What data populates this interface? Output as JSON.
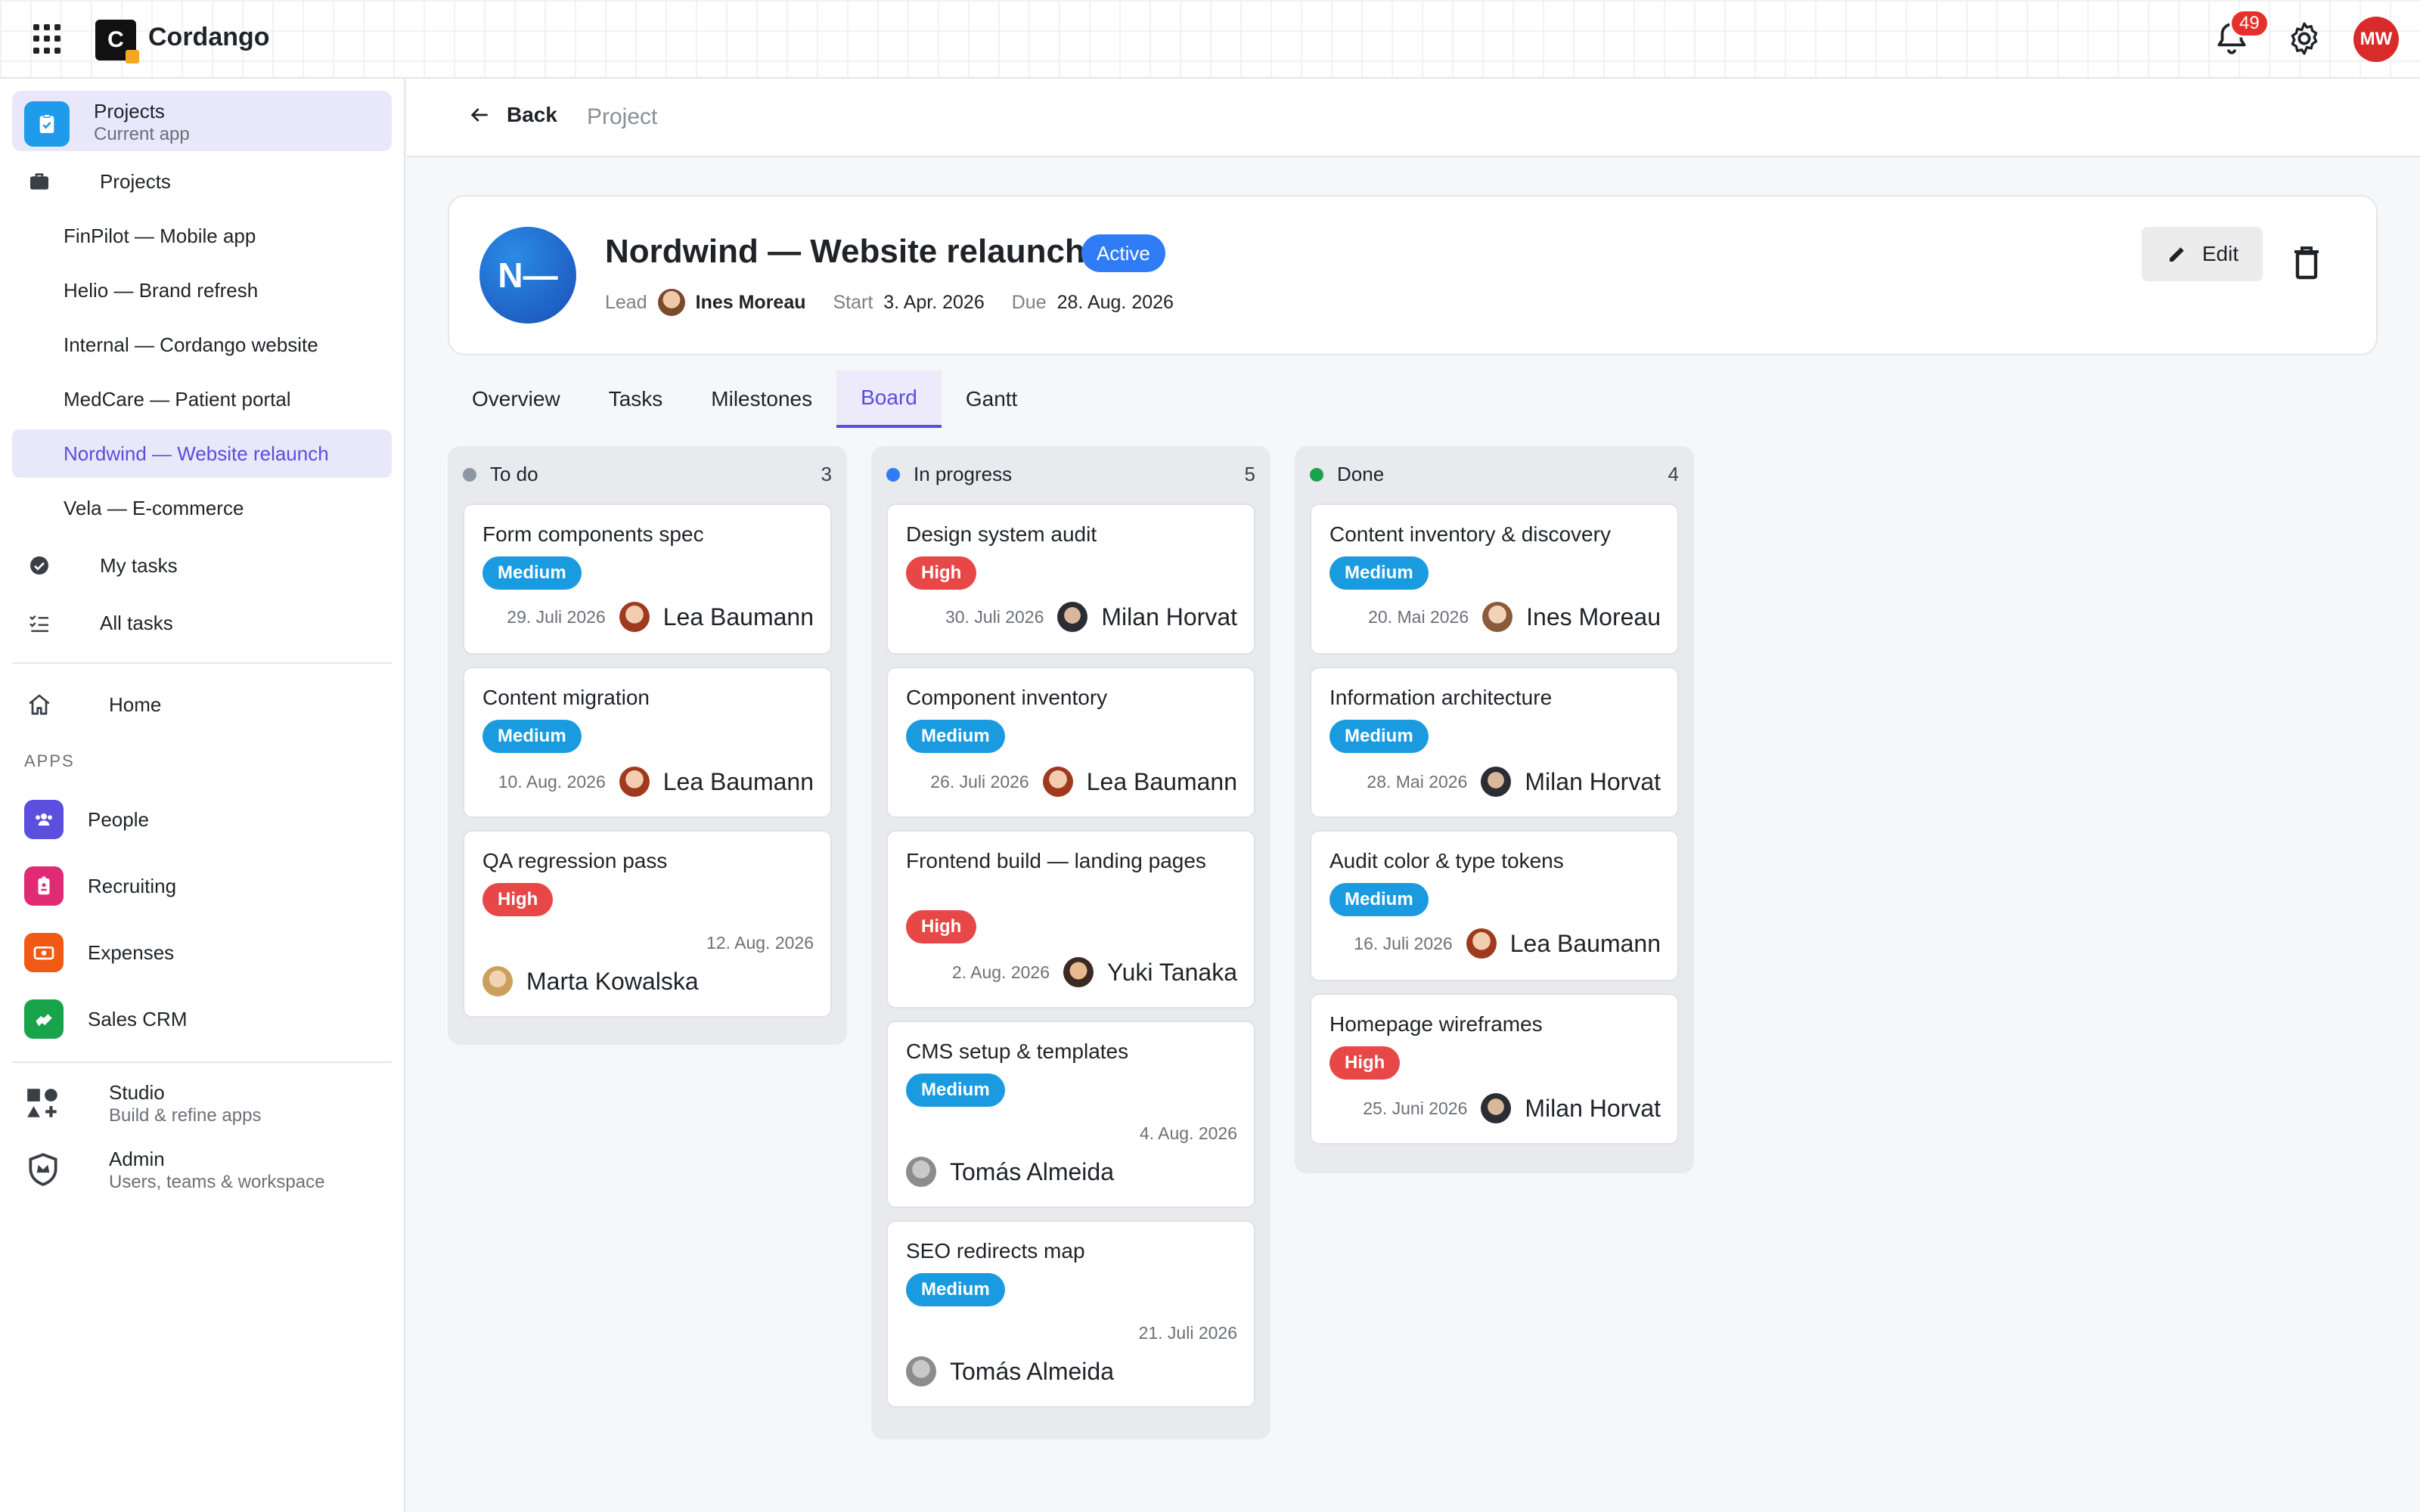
{
  "topbar": {
    "brand": "Cordango",
    "logo_letter": "C",
    "notifications_count": "49",
    "user_initials": "MW"
  },
  "sidebar": {
    "current_app": {
      "title": "Projects",
      "subtitle": "Current app"
    },
    "projects_label": "Projects",
    "projects": [
      "FinPilot — Mobile app",
      "Helio — Brand refresh",
      "Internal — Cordango website",
      "MedCare — Patient portal",
      "Nordwind — Website relaunch",
      "Vela — E-commerce"
    ],
    "active_project_index": 4,
    "my_tasks": "My tasks",
    "all_tasks": "All tasks",
    "home": "Home",
    "apps_heading": "APPS",
    "apps": [
      {
        "label": "People",
        "color": "#5b4fe0",
        "icon": "people-icon"
      },
      {
        "label": "Recruiting",
        "color": "#e02a74",
        "icon": "badge-icon"
      },
      {
        "label": "Expenses",
        "color": "#f05a14",
        "icon": "money-icon"
      },
      {
        "label": "Sales CRM",
        "color": "#19a34a",
        "icon": "handshake-icon"
      }
    ],
    "studio": {
      "title": "Studio",
      "subtitle": "Build & refine apps"
    },
    "admin": {
      "title": "Admin",
      "subtitle": "Users, teams & workspace"
    }
  },
  "breadcrumb": {
    "back": "Back",
    "current": "Project"
  },
  "project": {
    "initials": "N—",
    "title": "Nordwind — Website relaunch",
    "status": "Active",
    "lead_label": "Lead",
    "lead": "Ines Moreau",
    "start_label": "Start",
    "start": "3. Apr. 2026",
    "due_label": "Due",
    "due": "28. Aug. 2026",
    "edit_label": "Edit"
  },
  "tabs": [
    "Overview",
    "Tasks",
    "Milestones",
    "Board",
    "Gantt"
  ],
  "active_tab": "Board",
  "board": {
    "columns": [
      {
        "name": "To do",
        "count": "3",
        "color": "#8e96a3",
        "cards": [
          {
            "title": "Form components spec",
            "priority": "Medium",
            "date": "29. Juli 2026",
            "assignee": "Lea Baumann"
          },
          {
            "title": "Content migration",
            "priority": "Medium",
            "date": "10. Aug. 2026",
            "assignee": "Lea Baumann"
          },
          {
            "title": "QA regression pass",
            "priority": "High",
            "date": "12. Aug. 2026",
            "assignee": "Marta Kowalska"
          }
        ]
      },
      {
        "name": "In progress",
        "count": "5",
        "color": "#2f7cf6",
        "cards": [
          {
            "title": "Design system audit",
            "priority": "High",
            "date": "30. Juli 2026",
            "assignee": "Milan Horvat"
          },
          {
            "title": "Component inventory",
            "priority": "Medium",
            "date": "26. Juli 2026",
            "assignee": "Lea Baumann"
          },
          {
            "title": "Frontend build — landing pages",
            "priority": "High",
            "date": "2. Aug. 2026",
            "assignee": "Yuki Tanaka"
          },
          {
            "title": "CMS setup & templates",
            "priority": "Medium",
            "date": "4. Aug. 2026",
            "assignee": "Tomás Almeida"
          },
          {
            "title": "SEO redirects map",
            "priority": "Medium",
            "date": "21. Juli 2026",
            "assignee": "Tomás Almeida"
          }
        ]
      },
      {
        "name": "Done",
        "count": "4",
        "color": "#19a34a",
        "cards": [
          {
            "title": "Content inventory & discovery",
            "priority": "Medium",
            "date": "20. Mai 2026",
            "assignee": "Ines Moreau"
          },
          {
            "title": "Information architecture",
            "priority": "Medium",
            "date": "28. Mai 2026",
            "assignee": "Milan Horvat"
          },
          {
            "title": "Audit color & type tokens",
            "priority": "Medium",
            "date": "16. Juli 2026",
            "assignee": "Lea Baumann"
          },
          {
            "title": "Homepage wireframes",
            "priority": "High",
            "date": "25. Juni 2026",
            "assignee": "Milan Horvat"
          }
        ]
      }
    ]
  }
}
